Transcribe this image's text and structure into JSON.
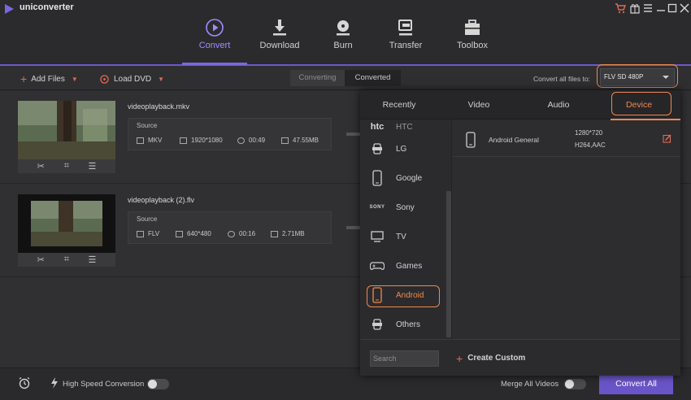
{
  "app": {
    "title": "uniconverter"
  },
  "nav": [
    {
      "label": "Convert",
      "icon": "play-circle-icon"
    },
    {
      "label": "Download",
      "icon": "download-icon"
    },
    {
      "label": "Burn",
      "icon": "disc-icon"
    },
    {
      "label": "Transfer",
      "icon": "transfer-icon"
    },
    {
      "label": "Toolbox",
      "icon": "toolbox-icon"
    }
  ],
  "toolbar": {
    "add_files": "Add Files",
    "load_dvd": "Load DVD",
    "seg_converting": "Converting",
    "seg_converted": "Converted",
    "convert_all_label": "Convert all files to:",
    "format_value": "FLV SD 480P"
  },
  "files": [
    {
      "name": "videoplayback.mkv",
      "source_label": "Source",
      "format": "MKV",
      "resolution": "1920*1080",
      "duration": "00:49",
      "size": "47.55MB"
    },
    {
      "name": "videoplayback (2).flv",
      "source_label": "Source",
      "format": "FLV",
      "resolution": "640*480",
      "duration": "00:16",
      "size": "2.71MB"
    }
  ],
  "panel": {
    "tabs": [
      "Recently",
      "Video",
      "Audio",
      "Device"
    ],
    "active_tab": "Device",
    "brands": [
      {
        "label": "HTC",
        "icon": "htc-logo-icon"
      },
      {
        "label": "LG",
        "icon": "lg-icon"
      },
      {
        "label": "Google",
        "icon": "phone-icon"
      },
      {
        "label": "Sony",
        "icon": "sony-logo-icon"
      },
      {
        "label": "TV",
        "icon": "tv-icon"
      },
      {
        "label": "Games",
        "icon": "gamepad-icon"
      },
      {
        "label": "Android",
        "icon": "android-phone-icon"
      },
      {
        "label": "Others",
        "icon": "others-icon"
      }
    ],
    "preset": {
      "name": "Android General",
      "resolution": "1280*720",
      "codec": "H264,AAC"
    },
    "search_placeholder": "Search",
    "create_custom": "Create Custom"
  },
  "bottom": {
    "high_speed_label": "High Speed Conversion",
    "merge_label": "Merge All Videos",
    "convert_all": "Convert All"
  },
  "colors": {
    "accent": "#6a55c8",
    "highlight": "#f0894f",
    "add_icon": "#e06a52"
  }
}
